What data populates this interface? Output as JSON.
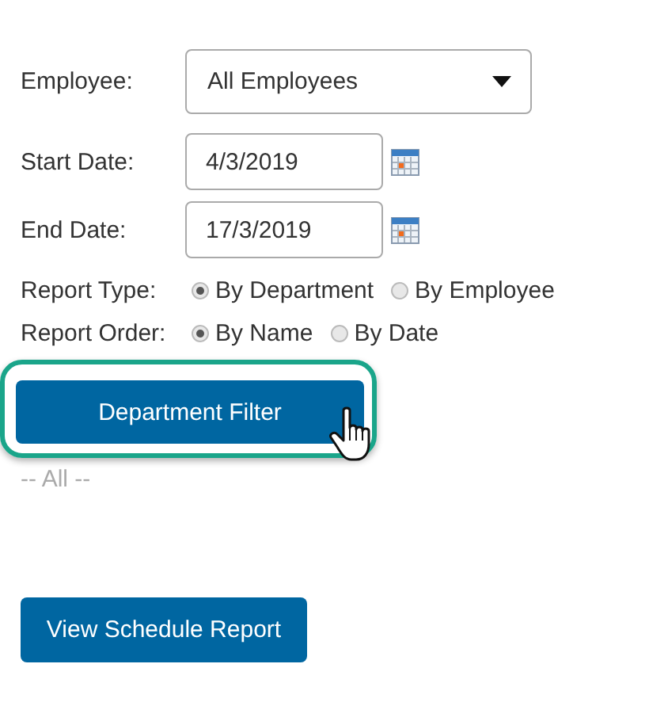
{
  "employee": {
    "label": "Employee:",
    "value": "All Employees"
  },
  "start_date": {
    "label": "Start Date:",
    "value": "4/3/2019"
  },
  "end_date": {
    "label": "End Date:",
    "value": "17/3/2019"
  },
  "report_type": {
    "label": "Report Type:",
    "options": [
      {
        "label": "By Department",
        "selected": true
      },
      {
        "label": "By Employee",
        "selected": false
      }
    ]
  },
  "report_order": {
    "label": "Report Order:",
    "options": [
      {
        "label": "By Name",
        "selected": true
      },
      {
        "label": "By Date",
        "selected": false
      }
    ]
  },
  "department_filter": {
    "label": "Department Filter",
    "highlighted": true,
    "value": "-- All --"
  },
  "submit": {
    "label": "View Schedule Report"
  }
}
